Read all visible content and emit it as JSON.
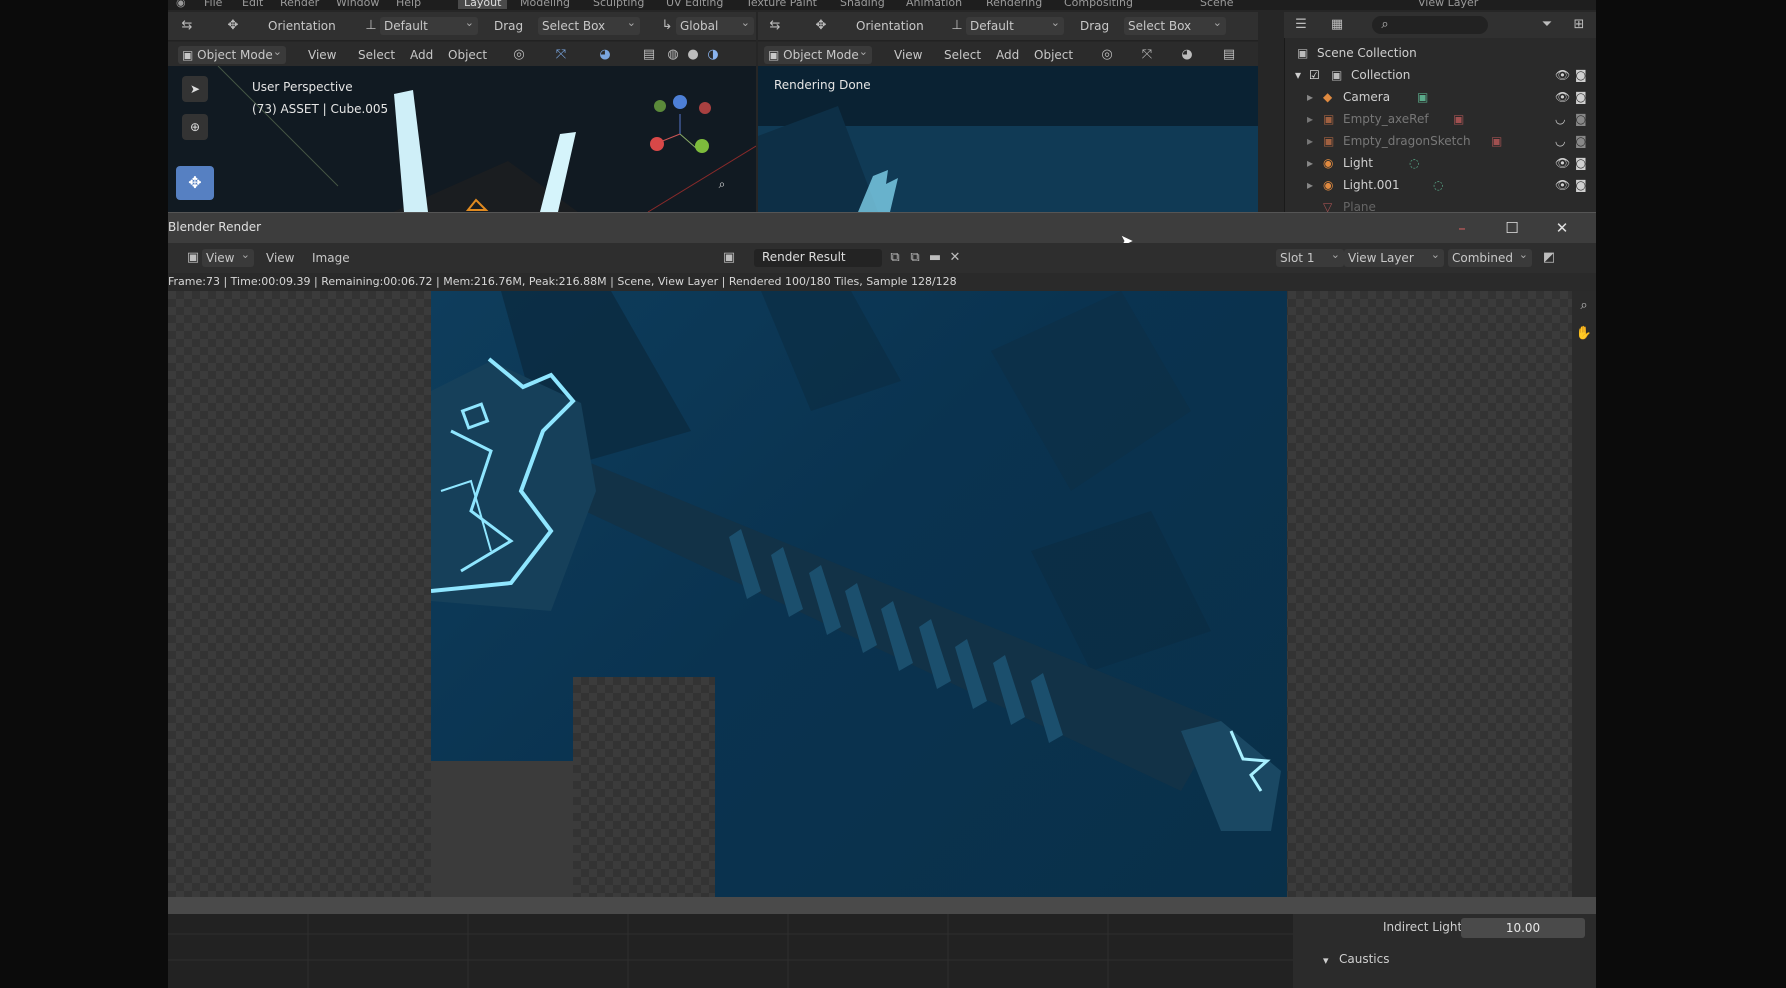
{
  "menubar": {
    "items": [
      "File",
      "Edit",
      "Render",
      "Window",
      "Help"
    ],
    "workspaces": [
      "Layout",
      "Modeling",
      "Sculpting",
      "UV Editing",
      "Texture Paint",
      "Shading",
      "Animation",
      "Rendering",
      "Compositing"
    ],
    "scene": "Scene",
    "view_layer": "View Layer"
  },
  "left_viewport": {
    "header": {
      "orientation_label": "Orientation",
      "orientation_value": "Default",
      "drag_label": "Drag",
      "drag_value": "Select Box",
      "transform": "Global"
    },
    "mode": "Object Mode",
    "menus": [
      "View",
      "Select",
      "Add",
      "Object"
    ],
    "overlay_title": "User Perspective",
    "overlay_subtitle": "(73) ASSET | Cube.005"
  },
  "right_viewport": {
    "header": {
      "orientation_label": "Orientation",
      "orientation_value": "Default",
      "drag_label": "Drag",
      "drag_value": "Select Box"
    },
    "mode": "Object Mode",
    "menus": [
      "View",
      "Select",
      "Add",
      "Object"
    ],
    "overlay_text": "Rendering Done"
  },
  "outliner": {
    "root": "Scene Collection",
    "items": [
      {
        "label": "Collection",
        "dim": false
      },
      {
        "label": "Camera",
        "dim": false
      },
      {
        "label": "Empty_axeRef",
        "dim": true
      },
      {
        "label": "Empty_dragonSketch",
        "dim": true
      },
      {
        "label": "Light",
        "dim": false
      },
      {
        "label": "Light.001",
        "dim": false
      },
      {
        "label": "Plane",
        "dim": true
      }
    ]
  },
  "render_window": {
    "title": "Blender Render",
    "menus": [
      "View",
      "View",
      "Image"
    ],
    "image_name": "Render Result",
    "slot": "Slot 1",
    "view_layer": "View Layer",
    "pass": "Combined",
    "status": "Frame:73 | Time:00:09.39 | Remaining:00:06.72 | Mem:216.76M, Peak:216.88M | Scene, View Layer | Rendered 100/180 Tiles, Sample 128/128"
  },
  "properties": {
    "indirect_light_label": "Indirect Light",
    "indirect_light_value": "10.00",
    "caustics_label": "Caustics"
  },
  "colors": {
    "render_blue": "#0e3d5c",
    "glow": "#7fe3ff",
    "accent": "#5680c2"
  }
}
